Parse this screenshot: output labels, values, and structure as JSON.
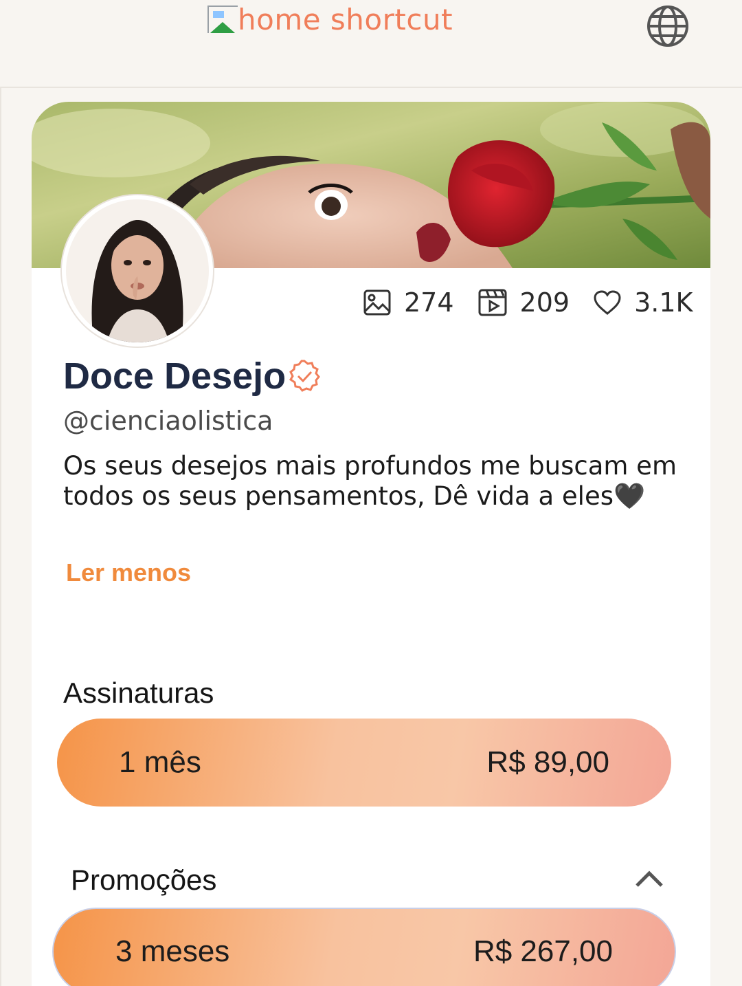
{
  "header": {
    "home_shortcut_alt": "home shortcut",
    "language_icon": "globe-icon"
  },
  "profile": {
    "name": "Doce Desejo",
    "handle": "@cienciaolistica",
    "bio": "Os seus desejos mais profundos me buscam em todos os seus pensamentos, Dê vida a eles🖤",
    "read_less": "Ler menos",
    "verified_icon": "verified-badge-icon",
    "stats": {
      "photos": "274",
      "videos": "209",
      "likes": "3.1K"
    }
  },
  "subscriptions": {
    "title": "Assinaturas",
    "plans": [
      {
        "label": "1 mês",
        "price": "R$ 89,00"
      }
    ]
  },
  "promotions": {
    "title": "Promoções",
    "plans": [
      {
        "label": "3 meses",
        "price": "R$ 267,00"
      }
    ]
  },
  "colors": {
    "accent": "#f07e5a",
    "name": "#1f2a44",
    "link": "#f08a3c"
  }
}
